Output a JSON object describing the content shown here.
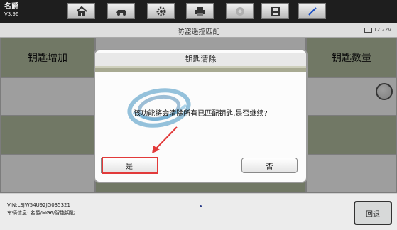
{
  "app": {
    "name": "名爵",
    "version": "V3.96"
  },
  "toolbar": {
    "items": [
      {
        "icon": "home-icon"
      },
      {
        "icon": "car-icon"
      },
      {
        "icon": "gear-icon"
      },
      {
        "icon": "printer-icon"
      },
      {
        "icon": "help-icon"
      },
      {
        "icon": "save-icon"
      },
      {
        "icon": "pen-icon"
      }
    ]
  },
  "header": {
    "title": "防盗遥控匹配",
    "voltage": "12.22V"
  },
  "main": {
    "key_add_label": "钥匙增加",
    "key_count_label": "钥匙数量"
  },
  "footer": {
    "vin": "VIN:LSJW54U92JG035321",
    "vehicle": "车辆信息: 名爵/MG6/智能钥匙",
    "back_label": "回退"
  },
  "dialog": {
    "title": "钥匙清除",
    "message": "该功能将会清除所有已匹配钥匙,是否继续?",
    "yes_label": "是",
    "no_label": "否"
  },
  "colors": {
    "highlight": "#e23a3a",
    "accent_green": "#b6c2a4",
    "strip": "#a8aa92"
  }
}
